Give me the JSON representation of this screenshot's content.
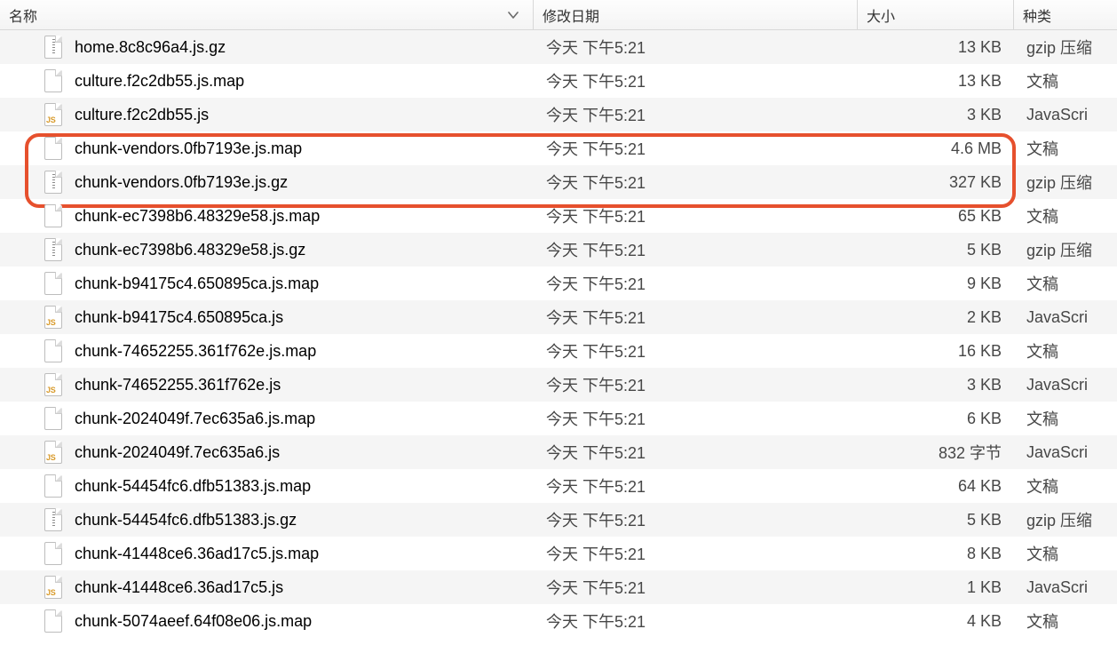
{
  "columns": {
    "name": "名称",
    "date": "修改日期",
    "size": "大小",
    "kind": "种类"
  },
  "files": [
    {
      "name": "home.8c8c96a4.js.gz",
      "date": "今天 下午5:21",
      "size": "13 KB",
      "kind": "gzip 压缩",
      "icon": "gz"
    },
    {
      "name": "culture.f2c2db55.js.map",
      "date": "今天 下午5:21",
      "size": "13 KB",
      "kind": "文稿",
      "icon": "doc"
    },
    {
      "name": "culture.f2c2db55.js",
      "date": "今天 下午5:21",
      "size": "3 KB",
      "kind": "JavaScri",
      "icon": "js"
    },
    {
      "name": "chunk-vendors.0fb7193e.js.map",
      "date": "今天 下午5:21",
      "size": "4.6 MB",
      "kind": "文稿",
      "icon": "doc"
    },
    {
      "name": "chunk-vendors.0fb7193e.js.gz",
      "date": "今天 下午5:21",
      "size": "327 KB",
      "kind": "gzip 压缩",
      "icon": "gz"
    },
    {
      "name": "chunk-ec7398b6.48329e58.js.map",
      "date": "今天 下午5:21",
      "size": "65 KB",
      "kind": "文稿",
      "icon": "doc"
    },
    {
      "name": "chunk-ec7398b6.48329e58.js.gz",
      "date": "今天 下午5:21",
      "size": "5 KB",
      "kind": "gzip 压缩",
      "icon": "gz"
    },
    {
      "name": "chunk-b94175c4.650895ca.js.map",
      "date": "今天 下午5:21",
      "size": "9 KB",
      "kind": "文稿",
      "icon": "doc"
    },
    {
      "name": "chunk-b94175c4.650895ca.js",
      "date": "今天 下午5:21",
      "size": "2 KB",
      "kind": "JavaScri",
      "icon": "js"
    },
    {
      "name": "chunk-74652255.361f762e.js.map",
      "date": "今天 下午5:21",
      "size": "16 KB",
      "kind": "文稿",
      "icon": "doc"
    },
    {
      "name": "chunk-74652255.361f762e.js",
      "date": "今天 下午5:21",
      "size": "3 KB",
      "kind": "JavaScri",
      "icon": "js"
    },
    {
      "name": "chunk-2024049f.7ec635a6.js.map",
      "date": "今天 下午5:21",
      "size": "6 KB",
      "kind": "文稿",
      "icon": "doc"
    },
    {
      "name": "chunk-2024049f.7ec635a6.js",
      "date": "今天 下午5:21",
      "size": "832 字节",
      "kind": "JavaScri",
      "icon": "js"
    },
    {
      "name": "chunk-54454fc6.dfb51383.js.map",
      "date": "今天 下午5:21",
      "size": "64 KB",
      "kind": "文稿",
      "icon": "doc"
    },
    {
      "name": "chunk-54454fc6.dfb51383.js.gz",
      "date": "今天 下午5:21",
      "size": "5 KB",
      "kind": "gzip 压缩",
      "icon": "gz"
    },
    {
      "name": "chunk-41448ce6.36ad17c5.js.map",
      "date": "今天 下午5:21",
      "size": "8 KB",
      "kind": "文稿",
      "icon": "doc"
    },
    {
      "name": "chunk-41448ce6.36ad17c5.js",
      "date": "今天 下午5:21",
      "size": "1 KB",
      "kind": "JavaScri",
      "icon": "js"
    },
    {
      "name": "chunk-5074aeef.64f08e06.js.map",
      "date": "今天 下午5:21",
      "size": "4 KB",
      "kind": "文稿",
      "icon": "doc"
    }
  ]
}
